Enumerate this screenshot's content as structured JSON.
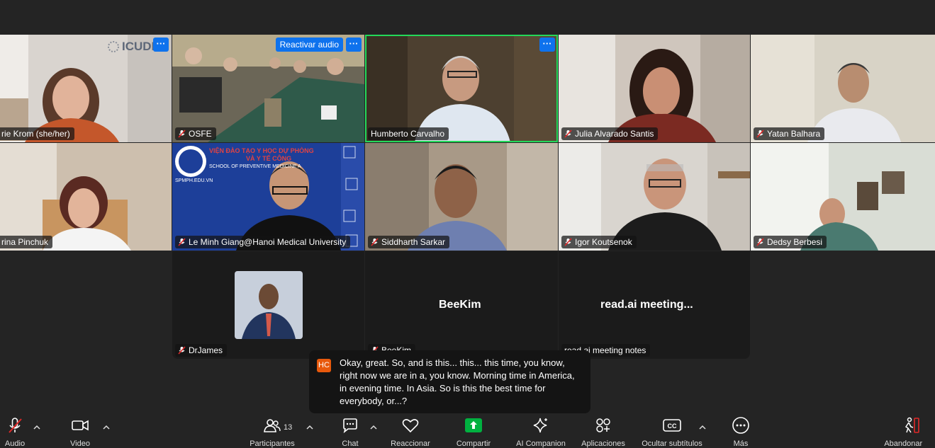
{
  "participants": [
    {
      "name": "rie Krom (she/her)",
      "muted": false
    },
    {
      "name": "OSFE",
      "muted": true
    },
    {
      "name": "Humberto Carvalho",
      "muted": false
    },
    {
      "name": "Julia Alvarado Santis",
      "muted": true
    },
    {
      "name": "Yatan Balhara",
      "muted": true
    },
    {
      "name": "rina Pinchuk",
      "muted": false
    },
    {
      "name": "Le Minh Giang@Hanoi Medical University",
      "muted": true
    },
    {
      "name": "Siddharth Sarkar",
      "muted": true
    },
    {
      "name": "Igor Koutsenok",
      "muted": true
    },
    {
      "name": "Dedsy Berbesi",
      "muted": true
    },
    {
      "name": "DrJames",
      "muted": true
    },
    {
      "name": "BeeKim",
      "muted": true,
      "display": "BeeKim"
    },
    {
      "name": "read.ai meeting notes",
      "muted": false,
      "display": "read.ai  meeting..."
    }
  ],
  "tile_text": {
    "icudd": "ICUDD",
    "reactivar": "Reactivar audio",
    "more": "···",
    "vien1": "VIỆN ĐÀO TẠO Y HỌC DỰ PHÒNG",
    "vien2": "VÀ Y TẾ CÔNG",
    "vien3": "SCHOOL OF PREVENTIVE MEDICINE A",
    "spmph": "SPMPH.EDU.VN"
  },
  "caption": {
    "initials": "HC",
    "text": "Okay, great. So, and is this... this... this time, you know, right now we are in a, you know. Morning time in America, in evening time. In Asia. So is this the best time for everybody, or...?"
  },
  "toolbar": {
    "audio": "Audio",
    "video": "Video",
    "participants": "Participantes",
    "participants_count": "13",
    "chat": "Chat",
    "react": "Reaccionar",
    "share": "Compartir",
    "ai": "AI Companion",
    "apps": "Aplicaciones",
    "cc": "Ocultar subtítulos",
    "more": "Más",
    "leave": "Abandonar"
  },
  "colors": {
    "background": "#242424",
    "accent_blue": "#0e72ed",
    "active_speaker": "#23d959",
    "share_green": "#00b140",
    "leave_red": "#e02828",
    "muted_red": "#e02828"
  }
}
